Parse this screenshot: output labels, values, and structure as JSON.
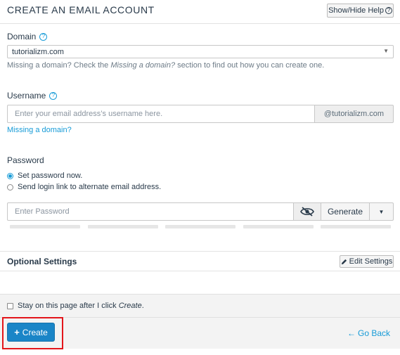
{
  "header": {
    "title": "CREATE AN EMAIL ACCOUNT",
    "help_button": "Show/Hide Help",
    "help_icon": "?"
  },
  "domain": {
    "label": "Domain",
    "help_icon": "?",
    "selected": "tutorializm.com",
    "caret": "▼",
    "help_prefix": "Missing a domain? Check the ",
    "help_italic": "Missing a domain?",
    "help_suffix": " section to find out how you can create one."
  },
  "username": {
    "label": "Username",
    "help_icon": "?",
    "placeholder": "Enter your email address’s username here.",
    "value": "",
    "domain_suffix": "@tutorializm.com",
    "missing_link": "Missing a domain?"
  },
  "password": {
    "label": "Password",
    "option_set_now": "Set password now.",
    "option_send_link": "Send login link to alternate email address.",
    "selected_option": "set_now",
    "placeholder": "Enter Password",
    "value": "",
    "generate_label": "Generate",
    "caret": "▼",
    "strength_segments": 5
  },
  "optional": {
    "title": "Optional Settings",
    "edit_button": "Edit Settings"
  },
  "footer": {
    "stay_prefix": "Stay on this page after I click ",
    "stay_italic": "Create",
    "stay_suffix": ".",
    "stay_checked": false,
    "create_icon": "+",
    "create_label": "Create",
    "goback_icon": "←",
    "goback_label": "Go Back"
  },
  "colors": {
    "accent": "#179bd7",
    "primary_button": "#1a85c7",
    "highlight": "#e3161b"
  }
}
